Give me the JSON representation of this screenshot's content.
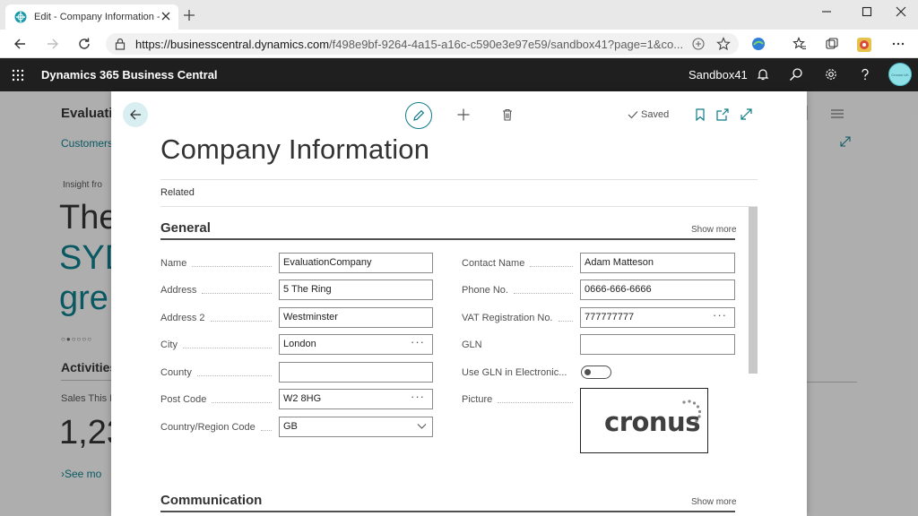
{
  "browser": {
    "tab_title": "Edit - Company Information - Dy",
    "url_host": "https://businesscentral.dynamics.com",
    "url_path": "/f498e9bf-9264-4a15-a16c-c590e3e97e59/sandbox41?page=1&co..."
  },
  "bc": {
    "app_name": "Dynamics 365 Business Central",
    "environment": "Sandbox41",
    "avatar_text": "Cronus UK Admin"
  },
  "background": {
    "title": "Evaluati",
    "nav": "Customers",
    "insight": "Insight fro",
    "big1": "The",
    "big2": "SYD",
    "big3": "gre",
    "activities": "Activities",
    "sales": "Sales This M",
    "number": "1,23",
    "see_more": "See mo"
  },
  "dialog": {
    "saved": "Saved",
    "title": "Company Information",
    "related": "Related",
    "general": {
      "title": "General",
      "show_more": "Show more",
      "fields_left": [
        {
          "label": "Name",
          "value": "EvaluationCompany"
        },
        {
          "label": "Address",
          "value": "5 The Ring"
        },
        {
          "label": "Address 2",
          "value": "Westminster"
        },
        {
          "label": "City",
          "value": "London"
        },
        {
          "label": "County",
          "value": ""
        },
        {
          "label": "Post Code",
          "value": "W2 8HG"
        },
        {
          "label": "Country/Region Code",
          "value": "GB"
        }
      ],
      "fields_right": [
        {
          "label": "Contact Name",
          "value": "Adam Matteson"
        },
        {
          "label": "Phone No.",
          "value": "0666-666-6666"
        },
        {
          "label": "VAT Registration No.",
          "value": "777777777"
        },
        {
          "label": "GLN",
          "value": ""
        },
        {
          "label": "Use GLN in Electronic...",
          "value": ""
        },
        {
          "label": "Picture",
          "value": ""
        }
      ],
      "picture_logo": "cronus"
    },
    "communication": {
      "title": "Communication",
      "show_more": "Show more"
    }
  },
  "colors": {
    "accent": "#0f7b88",
    "header_bg": "#1f1f1f"
  }
}
